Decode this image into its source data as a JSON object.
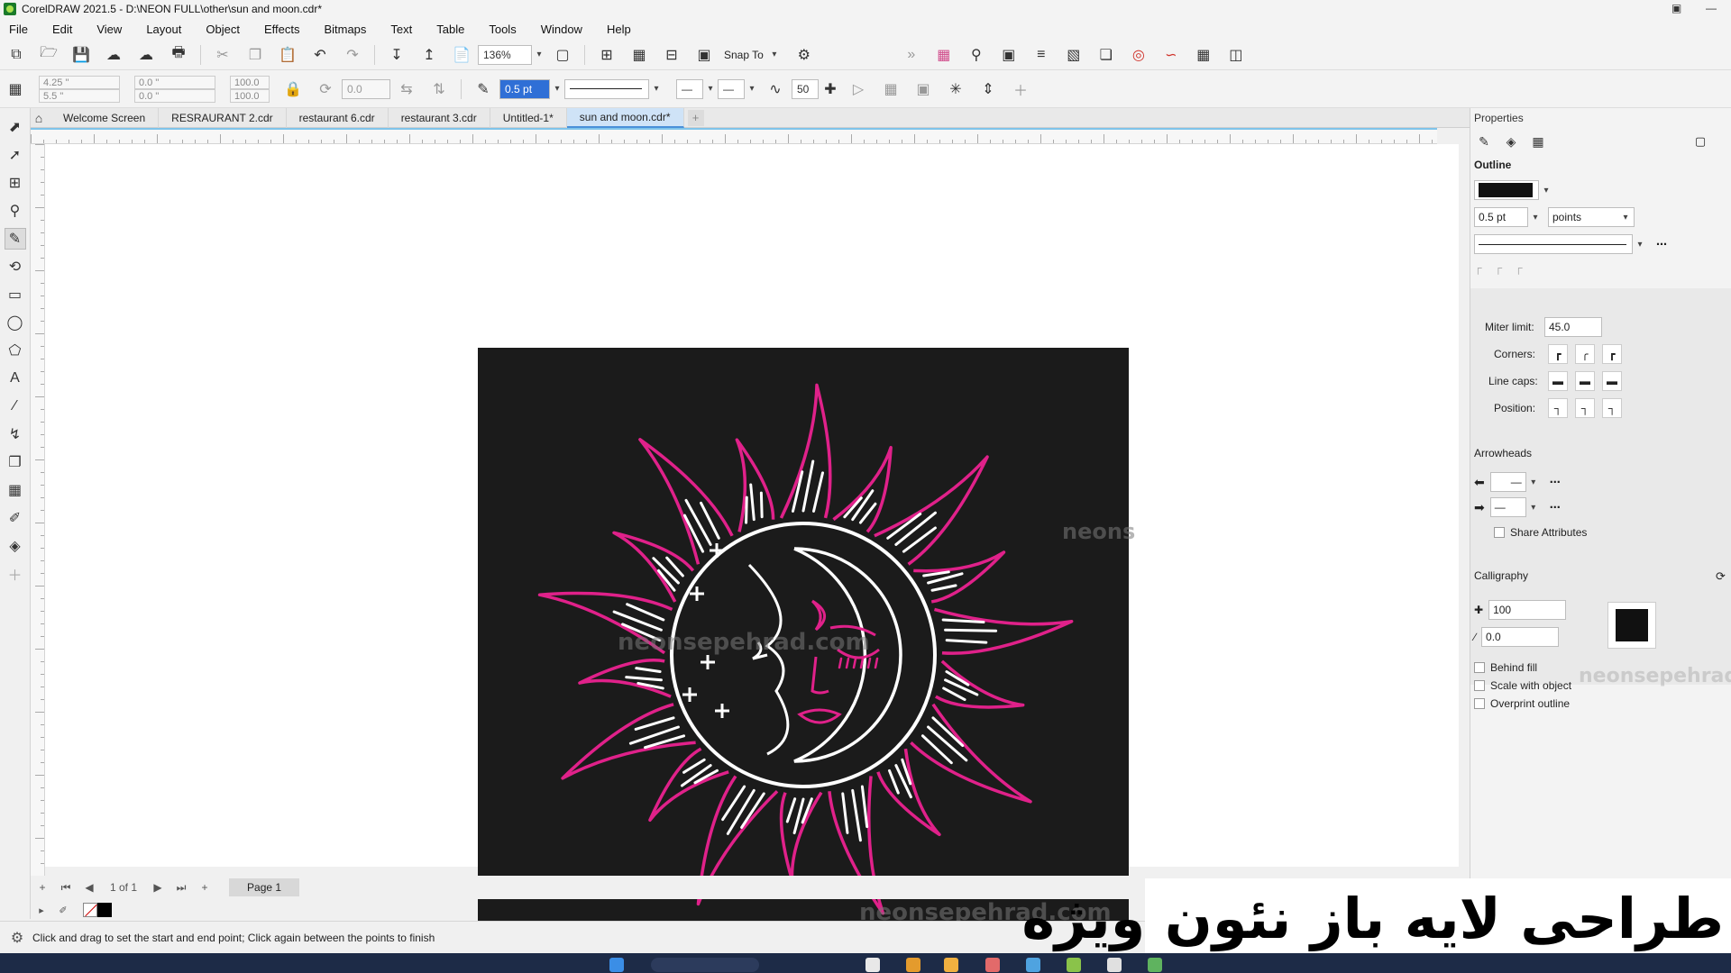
{
  "window": {
    "title": "CorelDRAW 2021.5 - D:\\NEON FULL\\other\\sun and moon.cdr*"
  },
  "menu": [
    "File",
    "Edit",
    "View",
    "Layout",
    "Object",
    "Effects",
    "Bitmaps",
    "Text",
    "Table",
    "Tools",
    "Window",
    "Help"
  ],
  "toolbar1": {
    "zoom": "136%",
    "snap_to": "Snap To"
  },
  "toolbar2": {
    "x": "4.25 \"",
    "y": "5.5 \"",
    "w": "0.0 \"",
    "h": "0.0 \"",
    "scale_w": "100.0",
    "scale_h": "100.0",
    "angle": "0.0",
    "outline_width": "0.5 pt",
    "smoothing": "50"
  },
  "tabs": [
    "Welcome Screen",
    "RESRAURANT 2.cdr",
    "restaurant 6.cdr",
    "restaurant 3.cdr",
    "Untitled-1*",
    "sun and moon.cdr*"
  ],
  "active_tab": "sun and moon.cdr*",
  "artwork": {
    "watermark_main": "neonsepehrad.com",
    "watermark_center": "neonsepehrad.com",
    "watermark_side": "neons",
    "sun_ray_color": "#e0218a",
    "line_color": "#ffffff",
    "background": "#1b1b1b"
  },
  "properties": {
    "title": "Properties",
    "outline_header": "Outline",
    "width": "0.5 pt",
    "units": "points",
    "miter_label": "Miter limit:",
    "miter_value": "45.0",
    "corners_label": "Corners:",
    "linecaps_label": "Line caps:",
    "position_label": "Position:",
    "arrowheads_header": "Arrowheads",
    "share_attributes": "Share Attributes",
    "calligraphy_header": "Calligraphy",
    "stretch": "100",
    "angle": "0.0",
    "behind_fill": "Behind fill",
    "scale_with_object": "Scale with object",
    "overprint_outline": "Overprint outline",
    "watermark": "neonsepehrad"
  },
  "pagebar": {
    "page_count": "1 of 1",
    "page_tab": "Page 1"
  },
  "status": {
    "message": "Click and drag to set the start and end point; Click again between the points to finish"
  },
  "caption": "طراحی لایه باز نئون ویژه"
}
